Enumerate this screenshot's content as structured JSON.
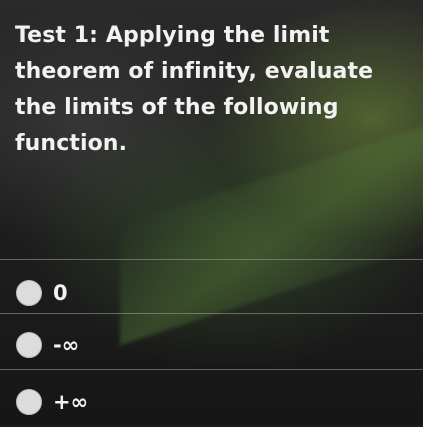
{
  "question": {
    "text": "Test 1: Applying the limit theorem of infinity, evaluate the limits of the following function."
  },
  "options": [
    {
      "label": "0",
      "selected": false
    },
    {
      "label": "-∞",
      "selected": false
    },
    {
      "label": "+∞",
      "selected": false
    }
  ]
}
